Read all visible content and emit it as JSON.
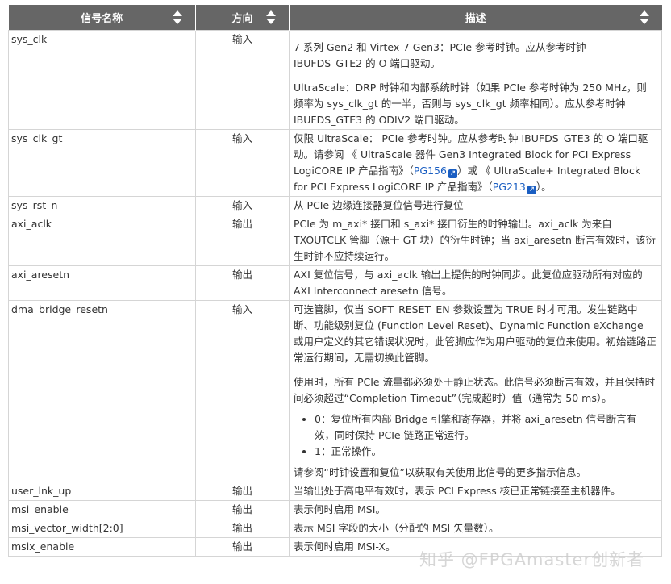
{
  "headers": [
    "信号名称",
    "方向",
    "描述"
  ],
  "rows": [
    {
      "name": "sys_clk",
      "dir": "输入",
      "blocks": [
        {
          "type": "p",
          "gap": true,
          "text": "7 系列 Gen2 和 Virtex-7 Gen3：PCIe 参考时钟。应从参考时钟 IBUFDS_GTE2 的 O 端口驱动。"
        },
        {
          "type": "p",
          "text": "UltraScale：DRP 时钟和内部系统时钟（如果 PCIe 参考时钟为 250 MHz，则频率为 sys_clk_gt 的一半，否则与 sys_clk_gt 频率相同）。应从参考时钟 IBUFDS_GTE3 的 ODIV2 端口驱动。"
        }
      ]
    },
    {
      "name": "sys_clk_gt",
      "dir": "输入",
      "blocks": [
        {
          "type": "rich",
          "parts": [
            {
              "text": "仅限 UltraScale： PCIe 参考时钟。应从参考时钟 IBUFDS_GTE3 的 O 端口驱动。请参阅 《 UltraScale 器件 Gen3 Integrated Block for PCI Express LogiCORE IP 产品指南》（"
            },
            {
              "link": "PG156"
            },
            {
              "text": "）或 《 UltraScale+ Integrated Block for PCI Express LogiCORE IP 产品指南》（"
            },
            {
              "link": "PG213"
            },
            {
              "text": "）。"
            }
          ]
        }
      ]
    },
    {
      "name": "sys_rst_n",
      "dir": "输入",
      "blocks": [
        {
          "type": "p",
          "text": "从 PCIe 边缘连接器复位信号进行复位"
        }
      ]
    },
    {
      "name": "axi_aclk",
      "dir": "输出",
      "blocks": [
        {
          "type": "p",
          "text": "PCIe 为 m_axi* 接口和 s_axi* 接口衍生的时钟输出。axi_aclk 为来自 TXOUTCLK 管脚（源于 GT 块）的衍生时钟；当 axi_aresetn 断言有效时，该衍生时钟不应持续运行。"
        }
      ]
    },
    {
      "name": "axi_aresetn",
      "dir": "输出",
      "blocks": [
        {
          "type": "p",
          "text": "AXI 复位信号，与 axi_aclk 输出上提供的时钟同步。此复位应驱动所有对应的 AXI Interconnect aresetn 信号。"
        }
      ]
    },
    {
      "name": "dma_bridge_resetn",
      "dir": "输入",
      "blocks": [
        {
          "type": "p",
          "text": "可选管脚，仅当 SOFT_RESET_EN 参数设置为 TRUE 时才可用。发生链路中断、功能级别复位 (Function Level Reset)、Dynamic Function eXchange 或用户定义的其它错误状况时，此管脚应作为用户驱动的复位来使用。初始链路正常运行期间，无需切换此管脚。"
        },
        {
          "type": "p",
          "text": "使用时，所有 PCIe 流量都必须处于静止状态。此信号必须断言有效，并且保持时间必须超过“Completion Timeout”（完成超时）值（通常为 50 ms）。"
        },
        {
          "type": "ul",
          "items": [
            "0：复位所有内部 Bridge 引擎和寄存器，并将 axi_aresetn 信号断言有效，同时保持 PCIe 链路正常运行。",
            "1：正常操作。"
          ]
        },
        {
          "type": "p",
          "text": "请参阅“时钟设置和复位”以获取有关使用此信号的更多指示信息。"
        }
      ]
    },
    {
      "name": "user_lnk_up",
      "dir": "输出",
      "blocks": [
        {
          "type": "p",
          "text": "当输出处于高电平有效时，表示 PCI Express 核已正常链接至主机器件。"
        }
      ]
    },
    {
      "name": "msi_enable",
      "dir": "输出",
      "blocks": [
        {
          "type": "p",
          "text": "表示何时启用 MSI。"
        }
      ]
    },
    {
      "name": "msi_vector_width[2:0]",
      "dir": "输出",
      "blocks": [
        {
          "type": "p",
          "text": "表示 MSI 字段的大小（分配的 MSI 矢量数）。"
        }
      ]
    },
    {
      "name": "msix_enable",
      "dir": "输出",
      "blocks": [
        {
          "type": "p",
          "text": "表示何时启用 MSI-X。"
        }
      ]
    }
  ],
  "watermark": "知乎 @FPGAmaster创新者",
  "colors": {
    "header_bg": "#666666",
    "link": "#1a5ec2",
    "border": "#d5d5d5"
  }
}
